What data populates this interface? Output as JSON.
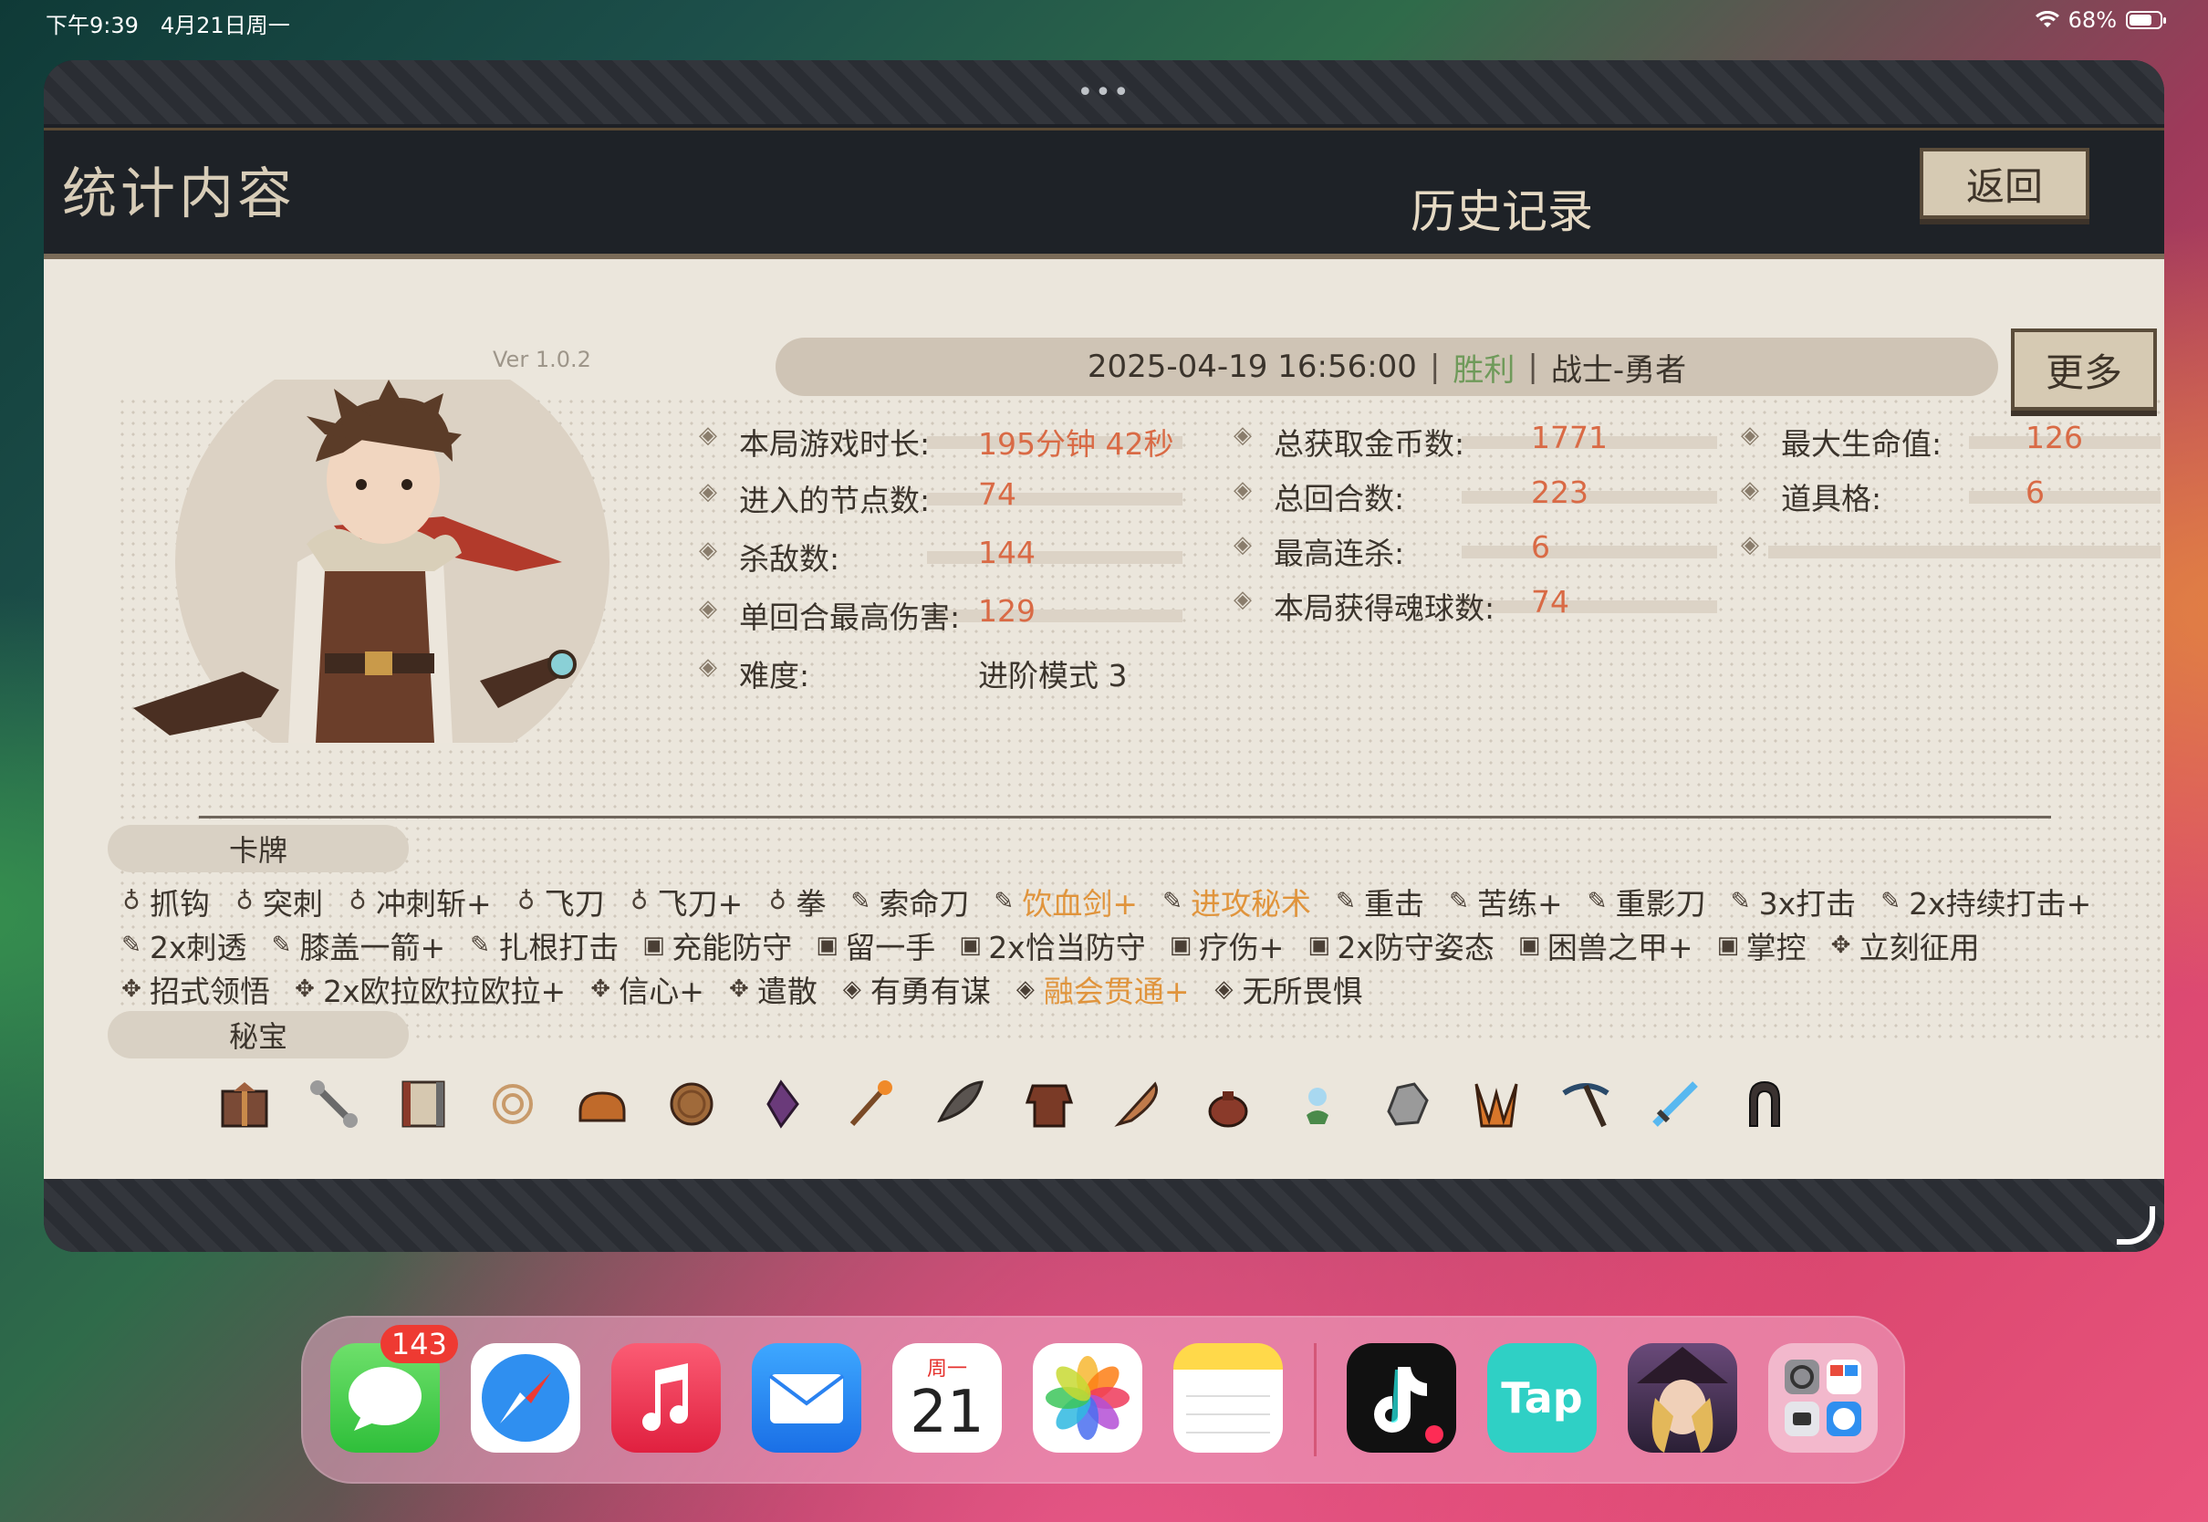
{
  "status_bar": {
    "time_date": "下午9:39　4月21日周一",
    "battery_pct": "68%",
    "battery_level": 0.68
  },
  "window": {
    "handle": "•••"
  },
  "header": {
    "title": "统计内容",
    "active_tab": "历史记录",
    "back_label": "返回"
  },
  "summary": {
    "version": "Ver 1.0.2",
    "datetime": "2025-04-19 16:56:00",
    "sep": "|",
    "result": "胜利",
    "character": "战士-勇者",
    "more_label": "更多"
  },
  "stats": {
    "col1": [
      {
        "label": "本局游戏时长:",
        "value": "195分钟 42秒"
      },
      {
        "label": "进入的节点数:",
        "value": "74"
      },
      {
        "label": "杀敌数:",
        "value": "144"
      },
      {
        "label": "单回合最高伤害:",
        "value": "129"
      },
      {
        "label": "难度:",
        "value": "进阶模式 3"
      }
    ],
    "col2": [
      {
        "label": "总获取金币数:",
        "value": "1771"
      },
      {
        "label": "总回合数:",
        "value": "223"
      },
      {
        "label": "最高连杀:",
        "value": "6"
      },
      {
        "label": "本局获得魂球数:",
        "value": "74"
      }
    ],
    "col3": [
      {
        "label": "最大生命值:",
        "value": "126"
      },
      {
        "label": "道具格:",
        "value": "6"
      },
      {
        "label": "",
        "value": ""
      }
    ]
  },
  "sections": {
    "cards_title": "卡牌",
    "relics_title": "秘宝"
  },
  "cards": {
    "row1": [
      "抓钩",
      "突刺",
      "冲刺斩+",
      "飞刀",
      "飞刀+",
      "拳",
      "索命刀",
      "饮血剑+",
      "进攻秘术",
      "重击",
      "苦练+",
      "重影刀",
      "3x打击",
      "2x持续打击+"
    ],
    "row2": [
      "2x刺透",
      "膝盖一箭+",
      "扎根打击",
      "充能防守",
      "留一手",
      "2x恰当防守",
      "疗伤+",
      "2x防守姿态",
      "困兽之甲+",
      "掌控",
      "立刻征用"
    ],
    "row3": [
      "招式领悟",
      "2x欧拉欧拉欧拉+",
      "信心+",
      "遣散",
      "有勇有谋",
      "融会贯通+",
      "无所畏惧"
    ]
  },
  "relics": [
    "gift-box-icon",
    "bone-wrench-icon",
    "scroll-map-icon",
    "rope-coil-icon",
    "bread-loaf-icon",
    "wooden-shield-icon",
    "purple-gem-icon",
    "fire-staff-icon",
    "stone-fang-icon",
    "leather-armor-icon",
    "feather-quill-icon",
    "coin-pouch-icon",
    "blue-flower-icon",
    "gray-ore-icon",
    "orange-claw-icon",
    "pickaxe-icon",
    "blue-sword-icon",
    "horseshoe-icon"
  ],
  "dock": {
    "messages_badge": "143",
    "calendar_day_label": "周一",
    "calendar_day": "21",
    "tap_label": "Tap"
  },
  "colors": {
    "accent_value": "#d96a45",
    "win": "#6f9a5a",
    "gold_card": "#e0943c"
  }
}
